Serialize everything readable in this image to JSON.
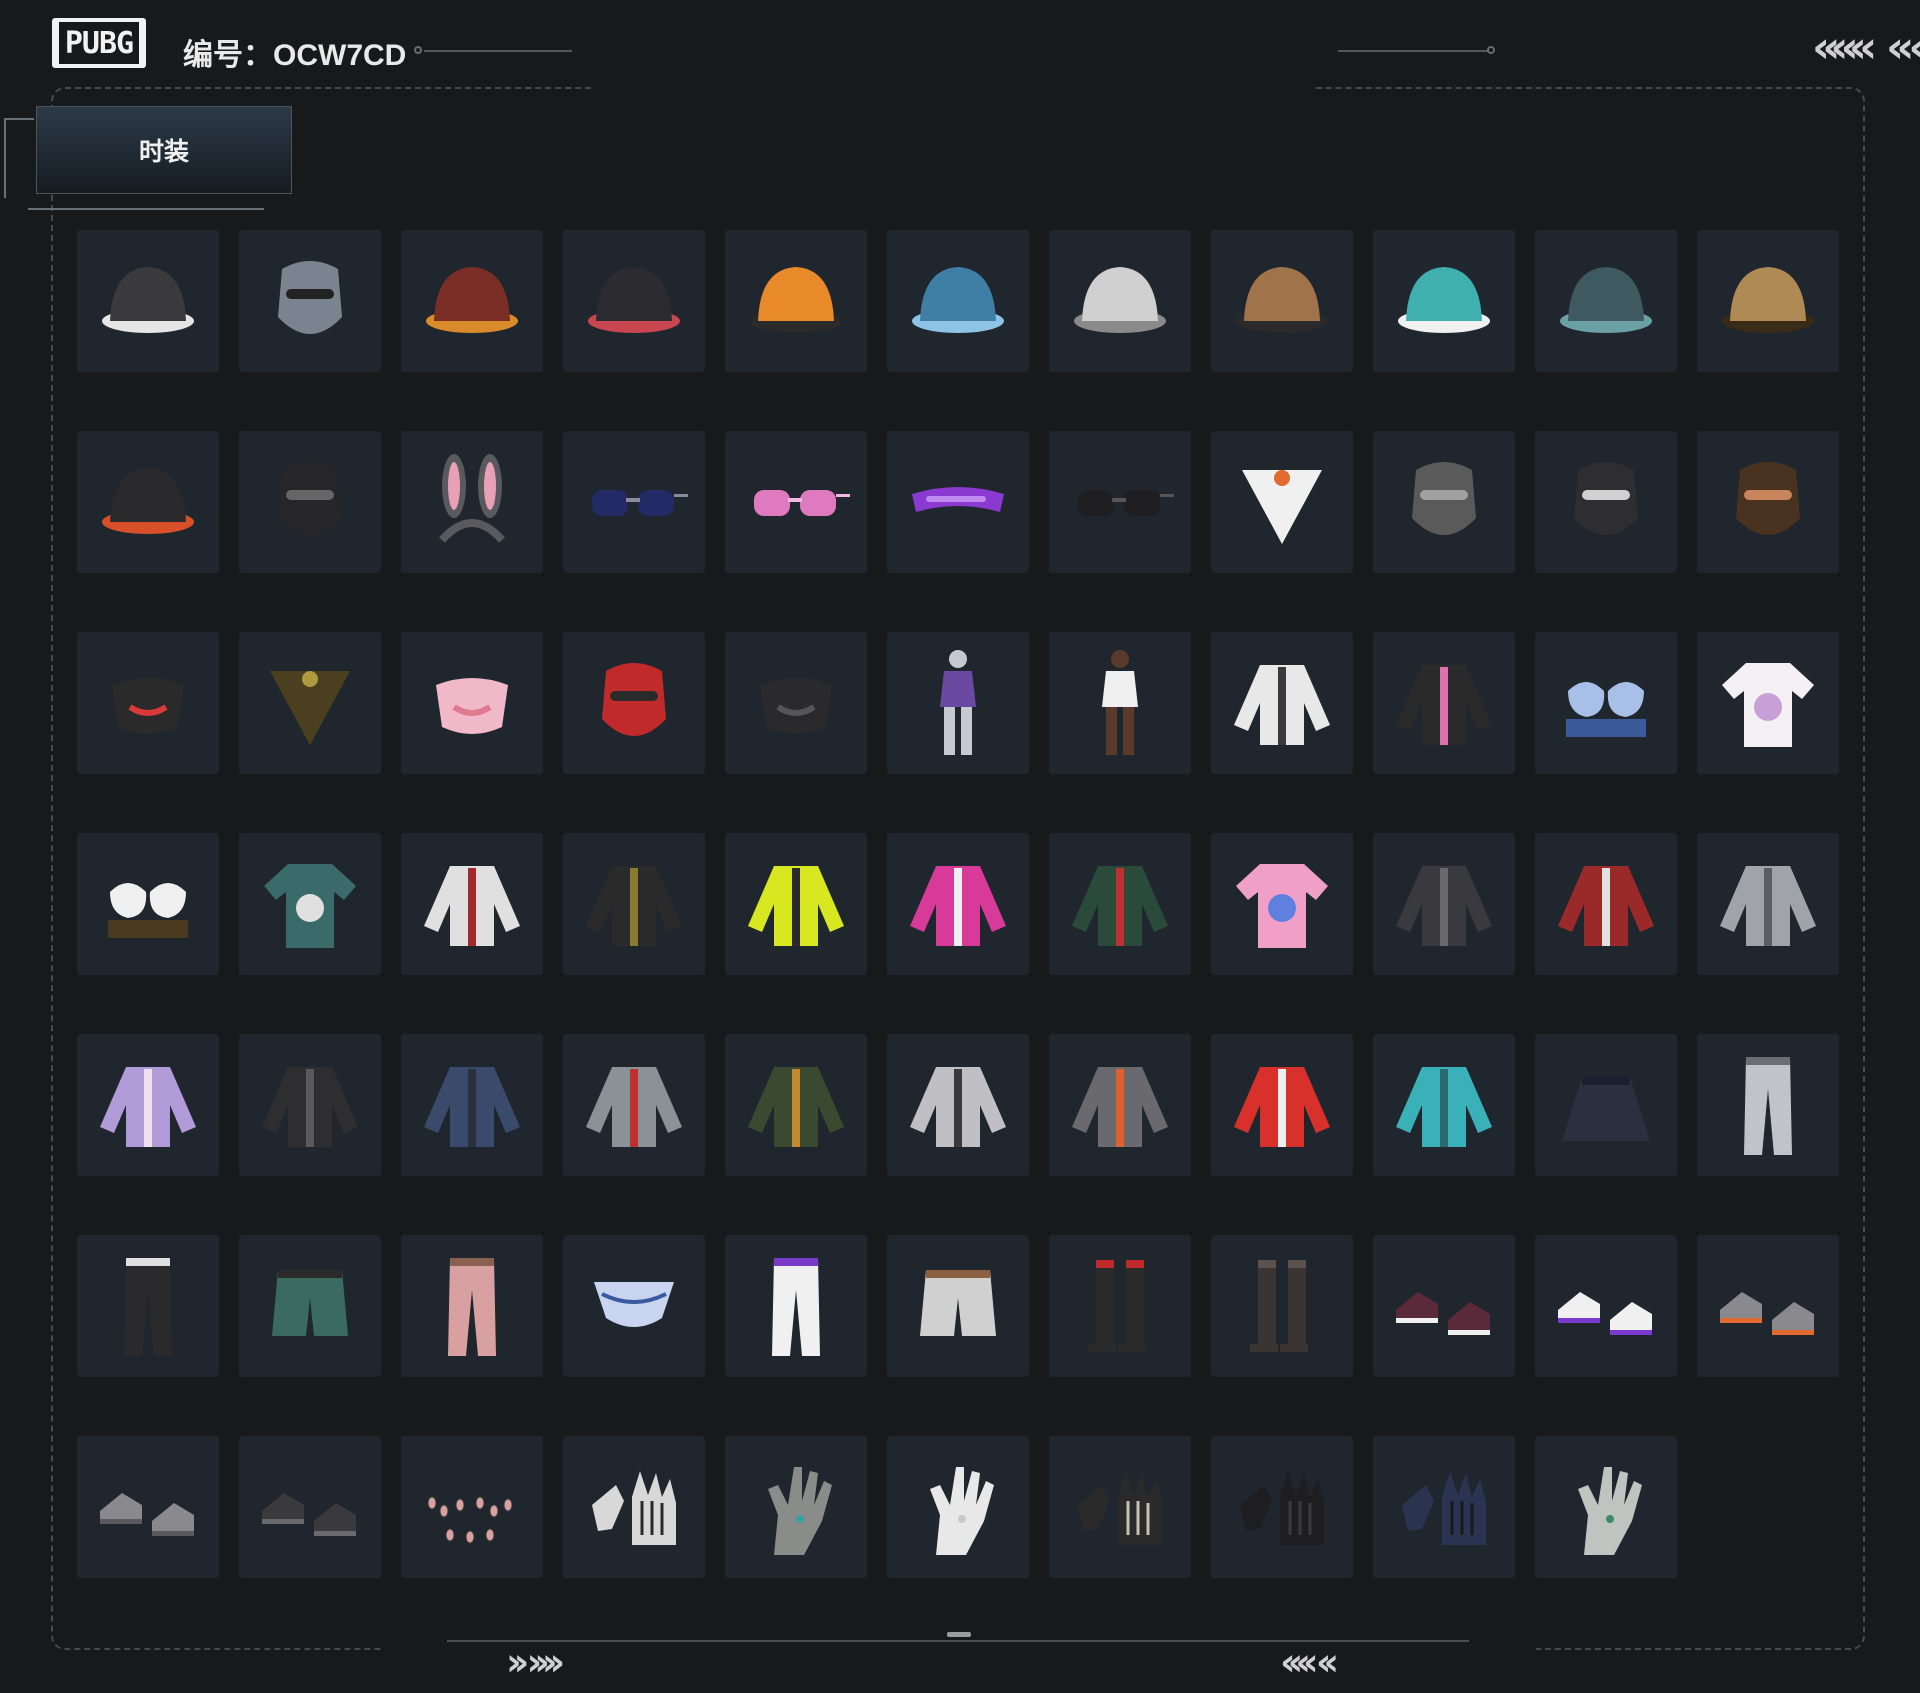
{
  "header": {
    "logo_text": "PUBG",
    "id_text": "编号：OCW7CD",
    "left_chevrons": "«««",
    "right_chevrons": "««‹"
  },
  "tabs": [
    {
      "label": "时装",
      "active": true
    }
  ],
  "footer": {
    "left_chevrons": "›› ››››",
    "right_chevrons": "‹‹‹‹ ‹‹"
  },
  "colors": {
    "background": "#18191b",
    "cell_bg": "#20262d",
    "frame": "#47494d",
    "tab_bg": "#243039"
  },
  "items": [
    {
      "name": "penguin-beanie",
      "kind": "hat",
      "color": "#3a3a3c",
      "accent": "#e6e6e6"
    },
    {
      "name": "balaclava-goggles",
      "kind": "mask",
      "color": "#7a8491",
      "accent": "#222222"
    },
    {
      "name": "chicken-hat",
      "kind": "hat",
      "color": "#7a2e26",
      "accent": "#d98a2a"
    },
    {
      "name": "top-hat",
      "kind": "hat",
      "color": "#2c2c30",
      "accent": "#c74650"
    },
    {
      "name": "orange-beanie",
      "kind": "hat",
      "color": "#e8892a",
      "accent": "#2a2a2a"
    },
    {
      "name": "blue-beret",
      "kind": "hat",
      "color": "#3f7fa6",
      "accent": "#8fc3e6"
    },
    {
      "name": "white-bucket-hat",
      "kind": "hat",
      "color": "#cfcfcf",
      "accent": "#8a8a8a"
    },
    {
      "name": "aviator-cap-headset",
      "kind": "hat",
      "color": "#a0734a",
      "accent": "#2a2a2a"
    },
    {
      "name": "teal-fluffy-hat",
      "kind": "hat",
      "color": "#3fb0ae",
      "accent": "#f0f0f0"
    },
    {
      "name": "teal-bucket-hat",
      "kind": "hat",
      "color": "#3e5a60",
      "accent": "#6aa0a6"
    },
    {
      "name": "leopard-bucket-hat",
      "kind": "hat",
      "color": "#b08a55",
      "accent": "#3a2a18"
    },
    {
      "name": "black-cap",
      "kind": "hat",
      "color": "#2a2a2c",
      "accent": "#d8502a"
    },
    {
      "name": "horned-visor",
      "kind": "mask",
      "color": "#262628",
      "accent": "#666666"
    },
    {
      "name": "bunny-ears",
      "kind": "ears",
      "color": "#5a5a5e",
      "accent": "#e8a0b4"
    },
    {
      "name": "navy-sunglasses",
      "kind": "glasses",
      "color": "#232a66",
      "accent": "#8a8aa0"
    },
    {
      "name": "pink-round-glasses",
      "kind": "glasses",
      "color": "#e07ac0",
      "accent": "#f0b8e0"
    },
    {
      "name": "purple-visor",
      "kind": "visor",
      "color": "#8a3ad0",
      "accent": "#c08af0"
    },
    {
      "name": "black-sport-glasses",
      "kind": "glasses",
      "color": "#1e1e20",
      "accent": "#555555"
    },
    {
      "name": "snowman-bandana",
      "kind": "bandana",
      "color": "#f0f0f0",
      "accent": "#e06a30"
    },
    {
      "name": "gas-mask",
      "kind": "mask",
      "color": "#5a5a5a",
      "accent": "#a0a0a0"
    },
    {
      "name": "respirator-mask",
      "kind": "mask",
      "color": "#2e2e30",
      "accent": "#d0d0d0"
    },
    {
      "name": "chimp-mask",
      "kind": "mask",
      "color": "#4a3220",
      "accent": "#c8845a"
    },
    {
      "name": "graffiti-face-mask",
      "kind": "facemask",
      "color": "#2a2a2a",
      "accent": "#d83a3a"
    },
    {
      "name": "camo-scarf",
      "kind": "bandana",
      "color": "#4a4020",
      "accent": "#b09a40"
    },
    {
      "name": "pink-face-mask",
      "kind": "facemask",
      "color": "#f0b8c8",
      "accent": "#e07a90"
    },
    {
      "name": "red-skull-mask",
      "kind": "mask",
      "color": "#c02a2a",
      "accent": "#2a2a2a"
    },
    {
      "name": "black-tactical-mask",
      "kind": "facemask",
      "color": "#2a2a2c",
      "accent": "#555555"
    },
    {
      "name": "purple-outfit",
      "kind": "figure",
      "color": "#6a4aa0",
      "accent": "#c8c8d0"
    },
    {
      "name": "white-bodysuit",
      "kind": "figure",
      "color": "#f0f0f0",
      "accent": "#5a3a2a"
    },
    {
      "name": "white-shirt-vest",
      "kind": "top",
      "color": "#e8e8e8",
      "accent": "#3a3a3c"
    },
    {
      "name": "pink-black-jacket",
      "kind": "top",
      "color": "#2a2a2a",
      "accent": "#e070b0"
    },
    {
      "name": "porcelain-bra-top",
      "kind": "bra",
      "color": "#a8c0e8",
      "accent": "#3a5a9a"
    },
    {
      "name": "cat-tshirt",
      "kind": "tshirt",
      "color": "#f4f0f4",
      "accent": "#c8a0d8"
    },
    {
      "name": "harness-bra-top",
      "kind": "bra",
      "color": "#f0f0f0",
      "accent": "#4a3a20"
    },
    {
      "name": "floral-shirt",
      "kind": "tshirt",
      "color": "#3a6a6a",
      "accent": "#e0e0e0"
    },
    {
      "name": "hooded-vest",
      "kind": "top",
      "color": "#e0e0e0",
      "accent": "#a02a2a"
    },
    {
      "name": "black-leather-coat",
      "kind": "top",
      "color": "#2a2a2a",
      "accent": "#8a7a30"
    },
    {
      "name": "neon-jersey",
      "kind": "top",
      "color": "#d8e820",
      "accent": "#2a2a2a"
    },
    {
      "name": "pink-long-sleeve",
      "kind": "top",
      "color": "#d83a9a",
      "accent": "#f0f0f0"
    },
    {
      "name": "floral-dress",
      "kind": "top",
      "color": "#2a4a3a",
      "accent": "#c03030"
    },
    {
      "name": "pink-anime-tshirt",
      "kind": "tshirt",
      "color": "#f0a0c8",
      "accent": "#6080e0"
    },
    {
      "name": "dark-gray-coat",
      "kind": "top",
      "color": "#3a3a3e",
      "accent": "#6a6a6e"
    },
    {
      "name": "red-blazer",
      "kind": "top",
      "color": "#9a2a2a",
      "accent": "#e0e0e0"
    },
    {
      "name": "gray-camo-hoodie",
      "kind": "top",
      "color": "#a0a4a8",
      "accent": "#5a5e62"
    },
    {
      "name": "purple-cat-hoodie",
      "kind": "top",
      "color": "#b09ad8",
      "accent": "#f0e0f0"
    },
    {
      "name": "black-tactical-hoodie",
      "kind": "top",
      "color": "#2e2e30",
      "accent": "#5a5a5e"
    },
    {
      "name": "navy-jacket",
      "kind": "top",
      "color": "#3a4a6a",
      "accent": "#2a3040"
    },
    {
      "name": "gray-track-jacket",
      "kind": "top",
      "color": "#8a9296",
      "accent": "#c03030"
    },
    {
      "name": "olive-bomber",
      "kind": "top",
      "color": "#3a4a30",
      "accent": "#c08a30"
    },
    {
      "name": "silver-jacket",
      "kind": "top",
      "color": "#c0c0c4",
      "accent": "#3a3a3c"
    },
    {
      "name": "gray-orange-jacket",
      "kind": "top",
      "color": "#6a6a6e",
      "accent": "#e06030"
    },
    {
      "name": "red-varsity-jacket",
      "kind": "top",
      "color": "#d8302a",
      "accent": "#f0f0f0"
    },
    {
      "name": "teal-hooded-jacket",
      "kind": "top",
      "color": "#3ab0b8",
      "accent": "#2a6a70"
    },
    {
      "name": "navy-skirt",
      "kind": "skirt",
      "color": "#2a3040",
      "accent": "#1a2030"
    },
    {
      "name": "white-camo-pants",
      "kind": "pants",
      "color": "#c0c4c8",
      "accent": "#6a6e72"
    },
    {
      "name": "white-black-tights",
      "kind": "pants",
      "color": "#2a2a2c",
      "accent": "#e0e0e0"
    },
    {
      "name": "teal-shorts",
      "kind": "shorts",
      "color": "#3a6a60",
      "accent": "#2a2a2a"
    },
    {
      "name": "pink-pants",
      "kind": "pants",
      "color": "#d8a0a0",
      "accent": "#8a6050"
    },
    {
      "name": "porcelain-briefs",
      "kind": "briefs",
      "color": "#c8d4f0",
      "accent": "#3a5aa0"
    },
    {
      "name": "purple-leggings",
      "kind": "pants",
      "color": "#f0f0f0",
      "accent": "#7a3ac8"
    },
    {
      "name": "white-cargo-shorts",
      "kind": "shorts",
      "color": "#d0d0d0",
      "accent": "#8a6040"
    },
    {
      "name": "thigh-high-socks",
      "kind": "boots",
      "color": "#2a2a2a",
      "accent": "#c02a2a"
    },
    {
      "name": "tall-boots",
      "kind": "boots",
      "color": "#3a3532",
      "accent": "#5a524e"
    },
    {
      "name": "purple-sneakers",
      "kind": "shoes",
      "color": "#5a2a3a",
      "accent": "#f0f0f0"
    },
    {
      "name": "white-purple-sneakers",
      "kind": "shoes",
      "color": "#f0f0f0",
      "accent": "#7a3ad0"
    },
    {
      "name": "gray-orange-sneakers",
      "kind": "shoes",
      "color": "#8a8a8e",
      "accent": "#e06a30"
    },
    {
      "name": "gray-socks",
      "kind": "shoes",
      "color": "#8a8a8e",
      "accent": "#5a5a5e"
    },
    {
      "name": "dark-gray-shoes",
      "kind": "shoes",
      "color": "#3a3a3c",
      "accent": "#6a6a6e"
    },
    {
      "name": "nail-set",
      "kind": "nails",
      "color": "#d8a0a0",
      "accent": "#3a3a3a"
    },
    {
      "name": "skeleton-gloves",
      "kind": "gloves",
      "color": "#d8d8d8",
      "accent": "#2a2a2a"
    },
    {
      "name": "gray-hand-ring",
      "kind": "hand",
      "color": "#8a8c8a",
      "accent": "#3aa0a0"
    },
    {
      "name": "white-gloves",
      "kind": "hand",
      "color": "#e8e8e8",
      "accent": "#c8c8c8"
    },
    {
      "name": "skeleton-tactical-gloves",
      "kind": "gloves",
      "color": "#2a2a2a",
      "accent": "#c8c0b0"
    },
    {
      "name": "black-gloves",
      "kind": "gloves",
      "color": "#1e1e20",
      "accent": "#3a3a3c"
    },
    {
      "name": "navy-gloves",
      "kind": "gloves",
      "color": "#2a3450",
      "accent": "#1a1a1c"
    },
    {
      "name": "pale-hand-rings",
      "kind": "hand",
      "color": "#c0c4c0",
      "accent": "#3a8a6a"
    }
  ]
}
